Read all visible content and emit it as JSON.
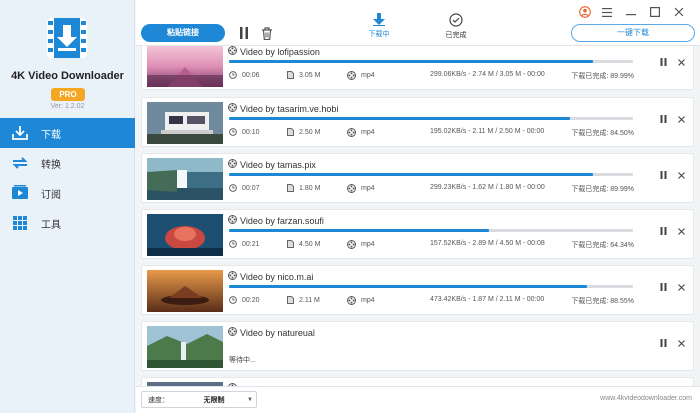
{
  "app": {
    "name": "4K Video Downloader",
    "badge": "PRO",
    "version": "Ver: 1.2.02",
    "brand_color": "#1e88d6"
  },
  "sidebar": {
    "items": [
      {
        "label": "下载",
        "icon": "download-icon",
        "active": true
      },
      {
        "label": "转换",
        "icon": "convert-icon",
        "active": false
      },
      {
        "label": "订阅",
        "icon": "subscribe-icon",
        "active": false
      },
      {
        "label": "工具",
        "icon": "tools-icon",
        "active": false
      }
    ]
  },
  "toolbar": {
    "paste_label": "粘贴链接",
    "tab_downloading": "下载中",
    "tab_completed": "已完成",
    "oneclick_label": "一键下载"
  },
  "downloads": [
    {
      "title": "Video by lofipassion",
      "duration": "00:06",
      "size": "3.05 M",
      "format": "mp4",
      "stats": "299.06KB/s - 2.74 M / 3.05 M - 00:00",
      "done_label": "下载已完成:",
      "percent": "89.99%",
      "progress": 0.8999
    },
    {
      "title": "Video by tasarim.ve.hobi",
      "duration": "00:10",
      "size": "2.50 M",
      "format": "mp4",
      "stats": "195.02KB/s - 2.11 M / 2.50 M - 00:00",
      "done_label": "下载已完成:",
      "percent": "84.50%",
      "progress": 0.845
    },
    {
      "title": "Video by tamas.pix",
      "duration": "00:07",
      "size": "1.80 M",
      "format": "mp4",
      "stats": "299.23KB/s - 1.62 M / 1.80 M - 00:00",
      "done_label": "下载已完成:",
      "percent": "89.99%",
      "progress": 0.8999
    },
    {
      "title": "Video by farzan.soufi",
      "duration": "00:21",
      "size": "4.50 M",
      "format": "mp4",
      "stats": "157.52KB/s - 2.89 M / 4.50 M - 00:08",
      "done_label": "下载已完成:",
      "percent": "64.34%",
      "progress": 0.6434
    },
    {
      "title": "Video by nico.m.ai",
      "duration": "00:20",
      "size": "2.11 M",
      "format": "mp4",
      "stats": "473.42KB/s - 1.87 M / 2.11 M - 00:00",
      "done_label": "下载已完成:",
      "percent": "88.55%",
      "progress": 0.8855
    },
    {
      "title": "Video by natureual",
      "status": "等待中..."
    }
  ],
  "footer": {
    "speed_label": "速度：",
    "speed_value": "无限制",
    "site": "www.4kvideodownloader.com"
  }
}
